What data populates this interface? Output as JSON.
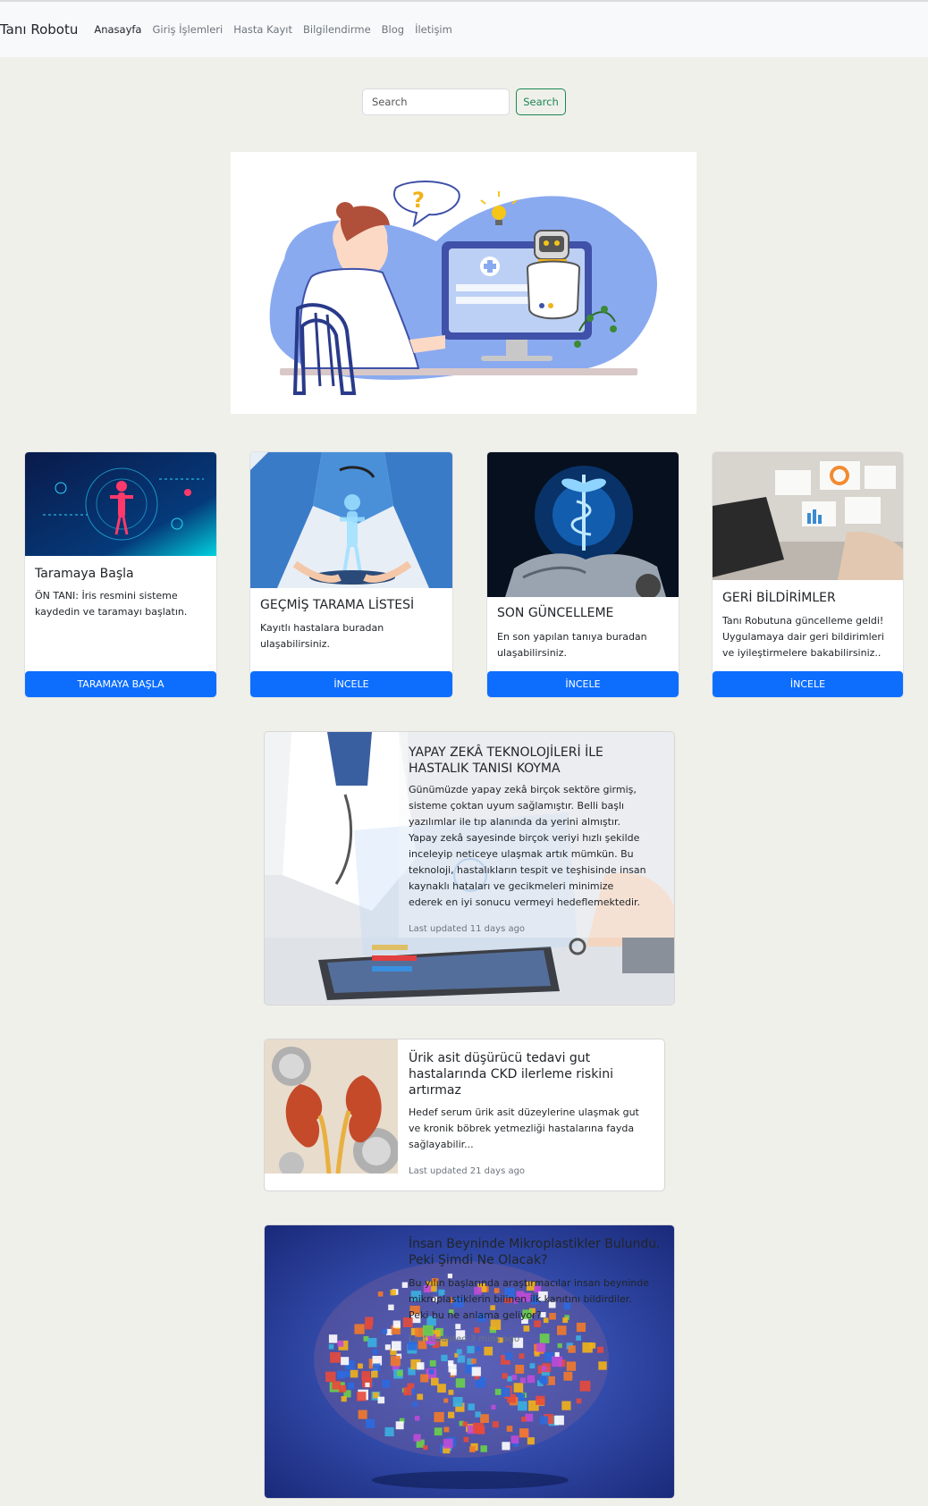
{
  "navbar": {
    "brand": "Tanı Robotu",
    "links": [
      "Anasayfa",
      "Giriş İşlemleri",
      "Hasta Kayıt",
      "Bilgilendirme",
      "Blog",
      "İletişim"
    ]
  },
  "search": {
    "placeholder": "Search",
    "button_label": "Search"
  },
  "cards": [
    {
      "title": "Taramaya Başla",
      "text": "ÖN TANI: İris resmini sisteme kaydedin ve taramayı başlatın.",
      "button": "TARAMAYA BAŞLA"
    },
    {
      "title": "GEÇMİŞ TARAMA LİSTESİ",
      "text": "Kayıtlı hastalara buradan ulaşabilirsiniz.",
      "button": "İNCELE"
    },
    {
      "title": "SON GÜNCELLEME",
      "text": "En son yapılan tanıya buradan ulaşabilirsiniz.",
      "button": "İNCELE"
    },
    {
      "title": "GERİ BİLDİRİMLER",
      "text": "Tanı Robutuna güncelleme geldi! Uygulamaya dair geri bildirimleri ve iyileştirmelere bakabilirsiniz..",
      "button": "İNCELE"
    }
  ],
  "articles": [
    {
      "title": "YAPAY ZEKÂ TEKNOLOJİLERİ İLE HASTALIK TANISI KOYMA",
      "text": "Günümüzde yapay zekâ birçok sektöre girmiş, sisteme çoktan uyum sağlamıştır. Belli başlı yazılımlar ile tıp alanında da yerini almıştır. Yapay zekâ sayesinde birçok veriyi hızlı şekilde inceleyip neticeye ulaşmak artık mümkün. Bu teknoloji, hastalıkların tespit ve teşhisinde insan kaynaklı hataları ve gecikmeleri minimize ederek en iyi sonucu vermeyi hedeflemektedir.",
      "meta": "Last updated 11 days ago"
    },
    {
      "title": "Ürik asit düşürücü tedavi gut hastalarında CKD ilerleme riskini artırmaz",
      "text": "Hedef serum ürik asit düzeylerine ulaşmak gut ve kronik böbrek yetmezliği hastalarına fayda sağlayabilir...",
      "meta": "Last updated 21 days ago"
    },
    {
      "title": "İnsan Beyninde Mikroplastikler Bulundu. Peki Şimdi Ne Olacak?",
      "text": "Bu yılın başlarında araştırmacılar insan beyninde mikroplastiklerin bilinen ilk kanıtını bildirdiler. Peki bu ne anlama geliyor?",
      "meta": "Last updated 3 mins ago"
    }
  ]
}
